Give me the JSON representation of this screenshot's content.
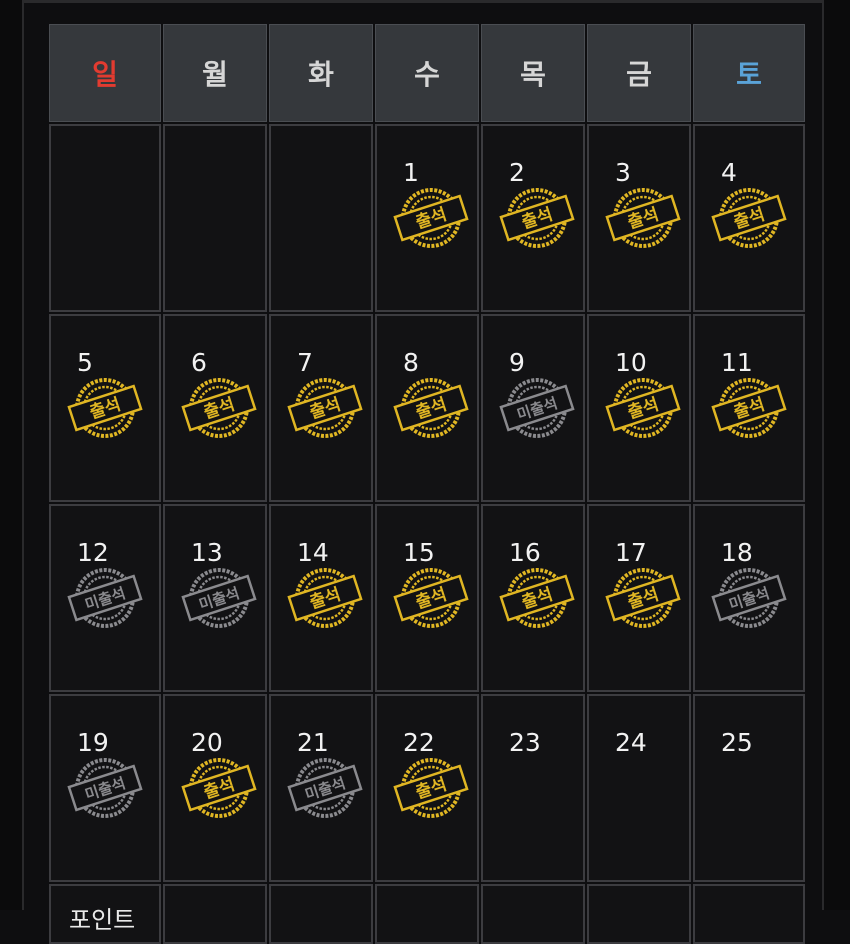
{
  "weekdays": [
    "일",
    "월",
    "화",
    "수",
    "목",
    "금",
    "토"
  ],
  "stamp_texts": {
    "attended": "출석",
    "absent": "미출석"
  },
  "colors": {
    "attended": "#e0b623",
    "absent": "#8a8a8e",
    "sunday": "#e23b30",
    "saturday": "#5aa3d8"
  },
  "days": [
    {
      "num": "",
      "status": "none"
    },
    {
      "num": "",
      "status": "none"
    },
    {
      "num": "",
      "status": "none"
    },
    {
      "num": "1",
      "status": "attended"
    },
    {
      "num": "2",
      "status": "attended"
    },
    {
      "num": "3",
      "status": "attended"
    },
    {
      "num": "4",
      "status": "attended"
    },
    {
      "num": "5",
      "status": "attended"
    },
    {
      "num": "6",
      "status": "attended"
    },
    {
      "num": "7",
      "status": "attended"
    },
    {
      "num": "8",
      "status": "attended"
    },
    {
      "num": "9",
      "status": "absent"
    },
    {
      "num": "10",
      "status": "attended"
    },
    {
      "num": "11",
      "status": "attended"
    },
    {
      "num": "12",
      "status": "absent"
    },
    {
      "num": "13",
      "status": "absent"
    },
    {
      "num": "14",
      "status": "attended"
    },
    {
      "num": "15",
      "status": "attended"
    },
    {
      "num": "16",
      "status": "attended"
    },
    {
      "num": "17",
      "status": "attended"
    },
    {
      "num": "18",
      "status": "absent"
    },
    {
      "num": "19",
      "status": "absent"
    },
    {
      "num": "20",
      "status": "attended"
    },
    {
      "num": "21",
      "status": "absent"
    },
    {
      "num": "22",
      "status": "attended"
    },
    {
      "num": "23",
      "status": "none"
    },
    {
      "num": "24",
      "status": "none"
    },
    {
      "num": "25",
      "status": "none"
    }
  ],
  "footer": {
    "label": "포인트"
  }
}
